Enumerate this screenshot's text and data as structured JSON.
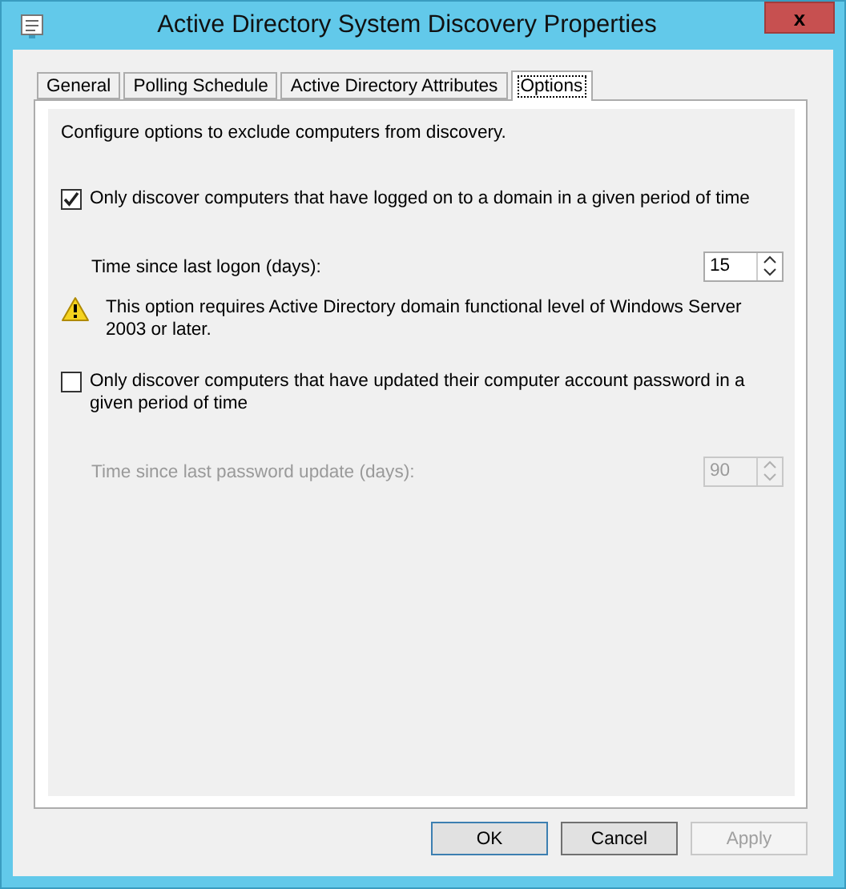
{
  "window": {
    "title": "Active Directory System Discovery Properties",
    "close": "x"
  },
  "tabs": [
    {
      "label": "General",
      "selected": false
    },
    {
      "label": "Polling Schedule",
      "selected": false
    },
    {
      "label": "Active Directory Attributes",
      "selected": false
    },
    {
      "label": "Options",
      "selected": true
    }
  ],
  "intro": "Configure options to exclude computers from discovery.",
  "options": [
    {
      "label": "Only discover computers that have logged on to a domain in a given period of time",
      "checked": true,
      "field": {
        "label": "Time since last logon (days):",
        "value": "15",
        "disabled": false
      },
      "warning": "This option requires Active Directory domain functional level of Windows Server 2003 or later."
    },
    {
      "label": "Only discover computers that have updated their computer account password in a given period of time",
      "checked": false,
      "field": {
        "label": "Time since last password update (days):",
        "value": "90",
        "disabled": true
      }
    }
  ],
  "buttons": [
    {
      "label": "OK",
      "disabled": false,
      "default": true
    },
    {
      "label": "Cancel",
      "disabled": false,
      "default": false
    },
    {
      "label": "Apply",
      "disabled": true,
      "default": false
    }
  ]
}
